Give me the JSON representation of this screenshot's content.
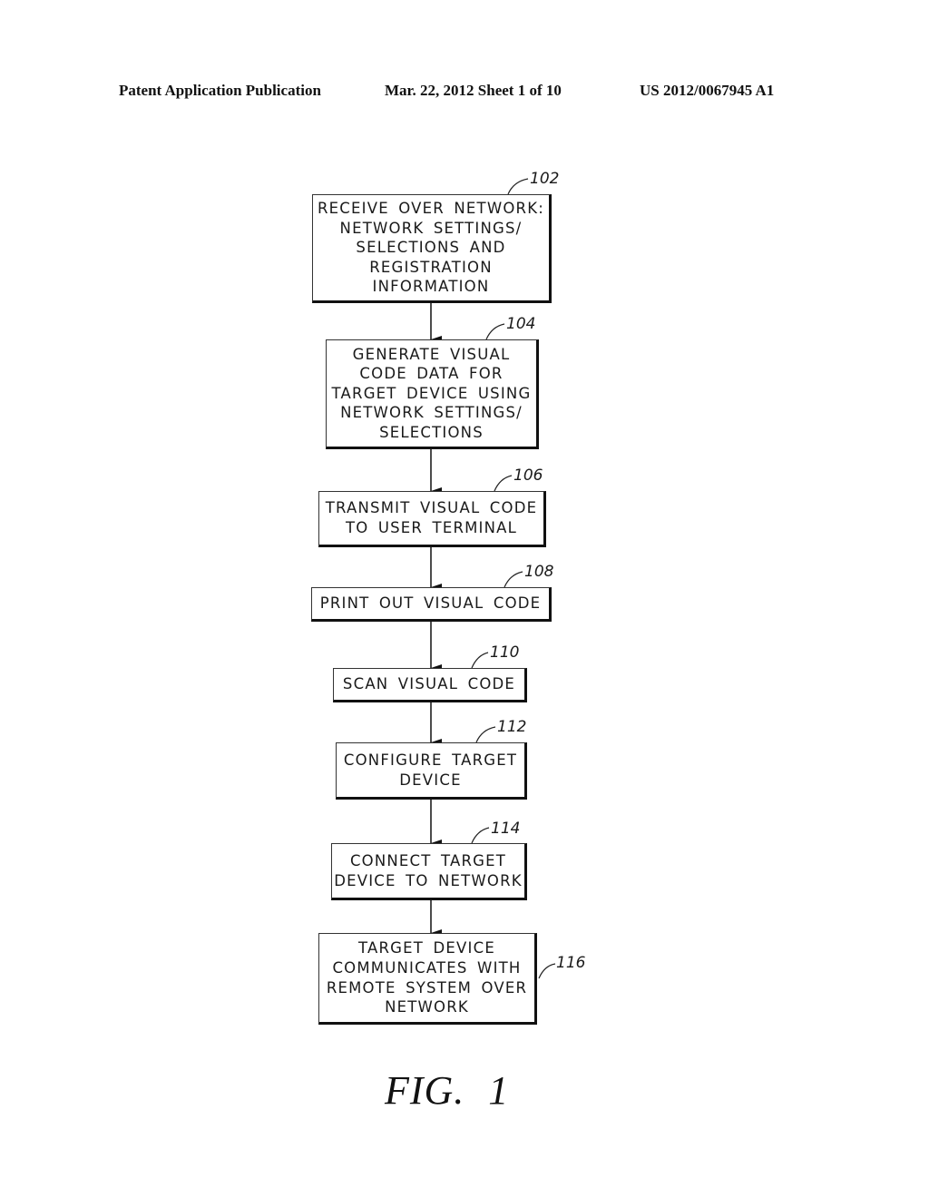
{
  "header": {
    "publication_type": "Patent Application Publication",
    "date_sheet": "Mar. 22, 2012  Sheet 1 of 10",
    "publication_number": "US 2012/0067945 A1"
  },
  "flowchart": {
    "steps": [
      {
        "ref": "102",
        "text": "RECEIVE OVER NETWORK:\nNETWORK SETTINGS/\nSELECTIONS AND\nREGISTRATION\nINFORMATION"
      },
      {
        "ref": "104",
        "text": "GENERATE VISUAL\nCODE DATA FOR\nTARGET DEVICE USING\nNETWORK SETTINGS/\nSELECTIONS"
      },
      {
        "ref": "106",
        "text": "TRANSMIT VISUAL CODE\nTO USER TERMINAL"
      },
      {
        "ref": "108",
        "text": "PRINT OUT VISUAL CODE"
      },
      {
        "ref": "110",
        "text": "SCAN VISUAL CODE"
      },
      {
        "ref": "112",
        "text": "CONFIGURE TARGET\nDEVICE"
      },
      {
        "ref": "114",
        "text": "CONNECT TARGET\nDEVICE TO NETWORK"
      },
      {
        "ref": "116",
        "text": "TARGET DEVICE\nCOMMUNICATES WITH\nREMOTE SYSTEM OVER\nNETWORK"
      }
    ]
  },
  "figure_label": "FIG. 1"
}
